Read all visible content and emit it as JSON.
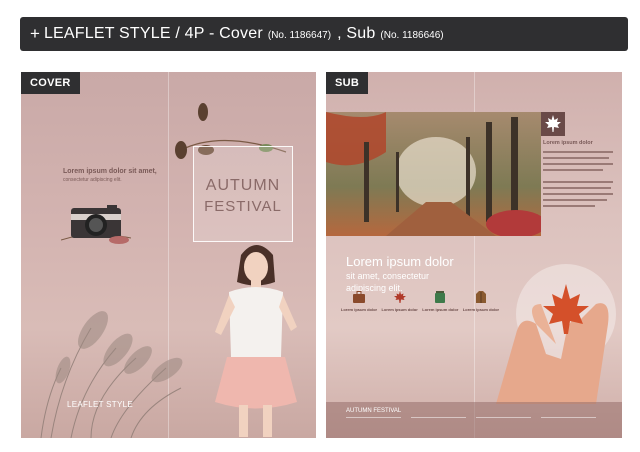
{
  "header": {
    "plus": "+",
    "title_part1": "LEAFLET STYLE / 4P - Cover",
    "cover_no": "(No. 1186647)",
    "separator": ", Sub",
    "sub_no": "(No. 1186646)"
  },
  "cover": {
    "tag": "COVER",
    "text_title": "Lorem ipsum dolor sit amet,",
    "text_desc": "consectetur adipiscing elit.",
    "autumn_line1": "AUTUMN",
    "autumn_line2": "FESTIVAL",
    "leaflet_label": "LEAFLET STYLE"
  },
  "sub": {
    "tag": "SUB",
    "info_title": "Lorem ipsum dolor",
    "heading_line1": "Lorem ipsum dolor",
    "heading_line2": "sit amet, consectetur",
    "heading_line3": "adipiscing elit.",
    "icons": [
      {
        "icon": "suitcase-icon",
        "caption": "Lorem ipsum dolor"
      },
      {
        "icon": "maple-leaf-icon",
        "caption": "Lorem ipsum dolor"
      },
      {
        "icon": "jar-icon",
        "caption": "Lorem ipsum dolor"
      },
      {
        "icon": "coat-icon",
        "caption": "Lorem ipsum dolor"
      }
    ],
    "footer_title": "AUTUMN FESTIVAL"
  },
  "colors": {
    "header_bg": "#2f2f31",
    "accent_dark": "#6a4a48",
    "text_brown": "#7a5a58"
  }
}
